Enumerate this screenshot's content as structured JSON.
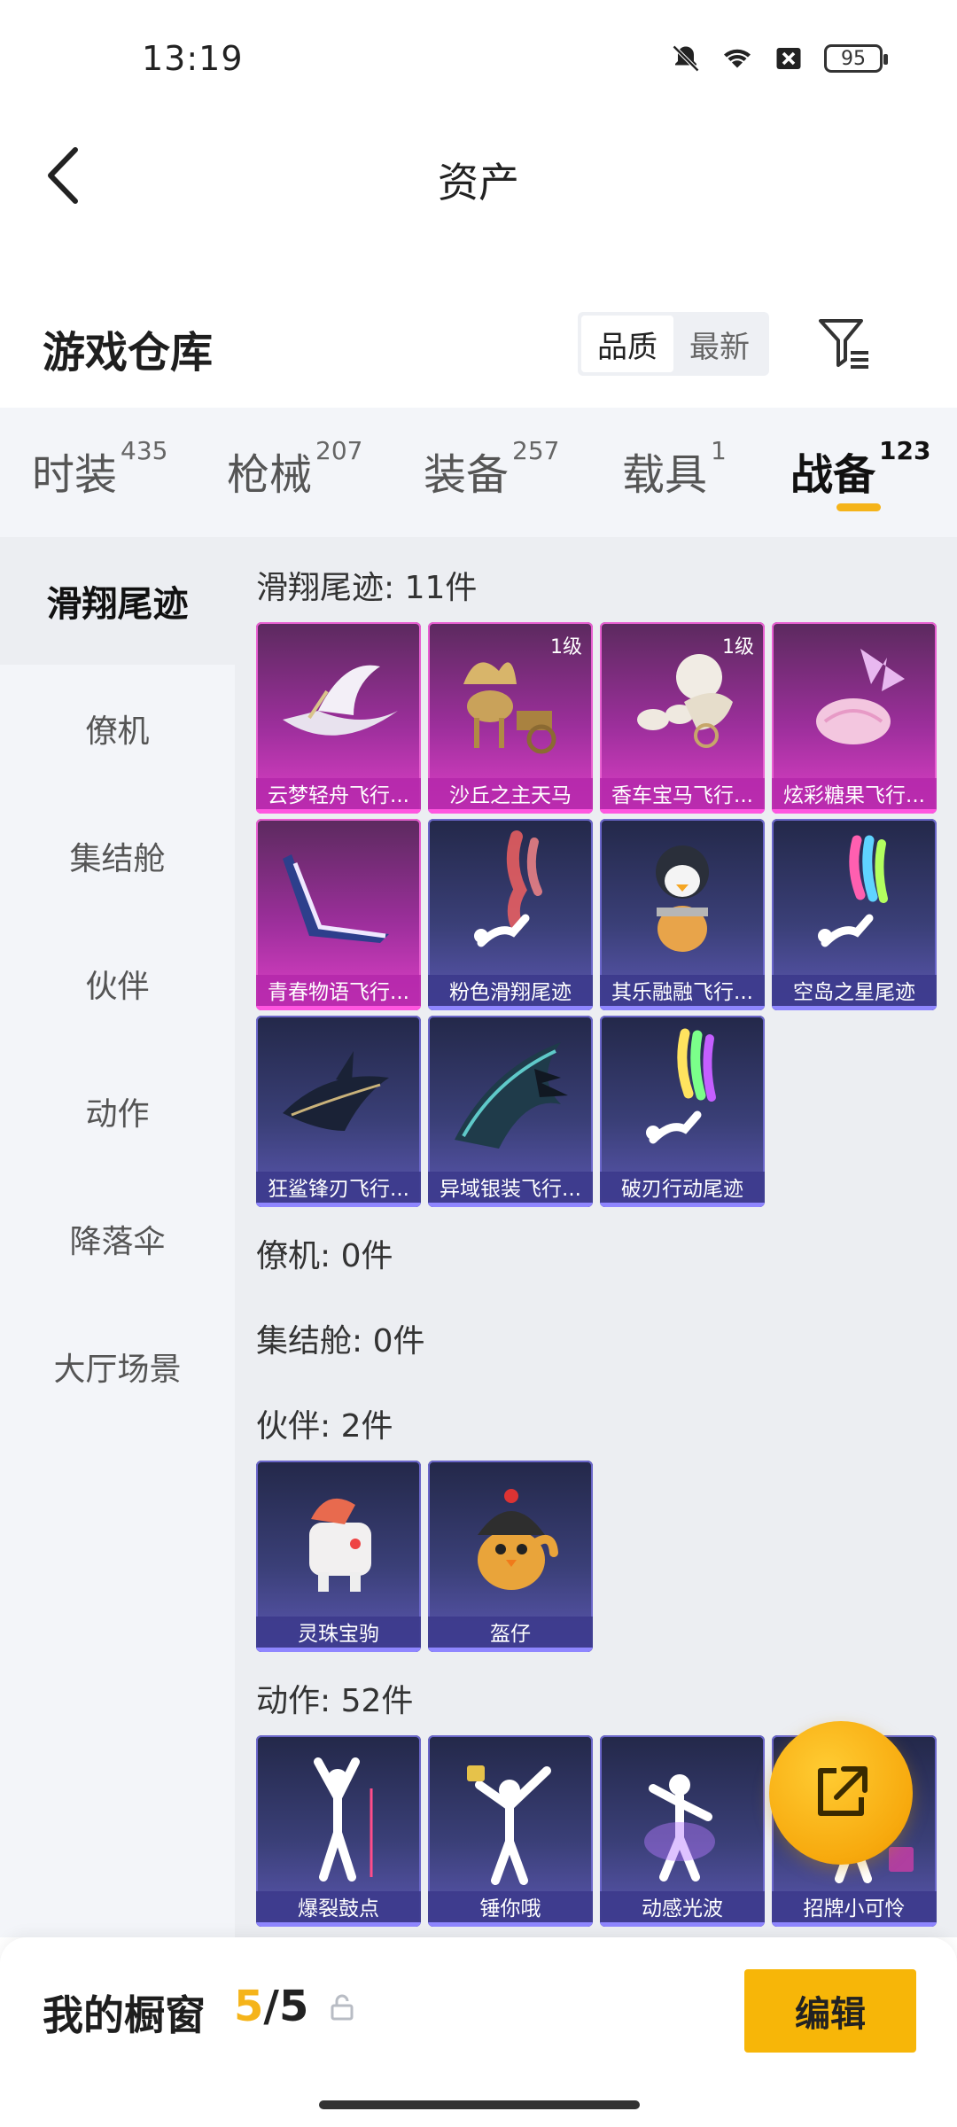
{
  "status_bar": {
    "time": "13:19",
    "battery": "95"
  },
  "header": {
    "title": "资产"
  },
  "warehouse": {
    "title": "游戏仓库",
    "sort_options": [
      "品质",
      "最新"
    ],
    "active_sort": "品质"
  },
  "tabs": [
    {
      "label": "时装",
      "count": "435"
    },
    {
      "label": "枪械",
      "count": "207"
    },
    {
      "label": "装备",
      "count": "257"
    },
    {
      "label": "载具",
      "count": "1"
    },
    {
      "label": "战备",
      "count": "123"
    }
  ],
  "active_tab": "战备",
  "sidebar": [
    {
      "label": "滑翔尾迹"
    },
    {
      "label": "僚机"
    },
    {
      "label": "集结舱"
    },
    {
      "label": "伙伴"
    },
    {
      "label": "动作"
    },
    {
      "label": "降落伞"
    },
    {
      "label": "大厅场景"
    }
  ],
  "sections": {
    "trails": {
      "heading": "滑翔尾迹: 11件",
      "items": [
        {
          "name": "云梦轻舟飞行...",
          "rarity": "pink",
          "level": "",
          "icon": "boat-glider-icon"
        },
        {
          "name": "沙丘之主天马",
          "rarity": "pink",
          "level": "1级",
          "icon": "pegasus-chariot-icon"
        },
        {
          "name": "香车宝马飞行...",
          "rarity": "pink",
          "level": "1级",
          "icon": "carriage-icon"
        },
        {
          "name": "炫彩糖果飞行...",
          "rarity": "pink",
          "level": "",
          "icon": "candy-icon"
        },
        {
          "name": "青春物语飞行...",
          "rarity": "pink",
          "level": "",
          "icon": "wing-glider-icon"
        },
        {
          "name": "粉色滑翔尾迹",
          "rarity": "navy",
          "level": "",
          "icon": "pink-smoke-icon"
        },
        {
          "name": "其乐融融飞行...",
          "rarity": "navy",
          "level": "",
          "icon": "penguin-icon"
        },
        {
          "name": "空岛之星尾迹",
          "rarity": "navy",
          "level": "",
          "icon": "rainbow-smoke-icon"
        },
        {
          "name": "狂鲨锋刃飞行...",
          "rarity": "navy",
          "level": "",
          "icon": "shark-icon"
        },
        {
          "name": "异域银装飞行...",
          "rarity": "navy",
          "level": "",
          "icon": "dark-wing-icon"
        },
        {
          "name": "破刃行动尾迹",
          "rarity": "navy",
          "level": "",
          "icon": "color-smoke-icon"
        }
      ]
    },
    "wingman": {
      "heading": "僚机: 0件"
    },
    "capsule": {
      "heading": "集结舱: 0件"
    },
    "partner": {
      "heading": "伙伴: 2件",
      "items": [
        {
          "name": "灵珠宝驹",
          "rarity": "navy",
          "level": "",
          "icon": "toy-horse-icon"
        },
        {
          "name": "盔仔",
          "rarity": "navy",
          "level": "",
          "icon": "helmet-chick-icon"
        }
      ]
    },
    "emote": {
      "heading": "动作: 52件",
      "items": [
        {
          "name": "爆裂鼓点",
          "rarity": "navy",
          "level": "",
          "icon": "dancer-icon"
        },
        {
          "name": "锤你哦",
          "rarity": "navy",
          "level": "",
          "icon": "hammer-dancer-icon"
        },
        {
          "name": "动感光波",
          "rarity": "navy",
          "level": "",
          "icon": "wave-dancer-icon"
        },
        {
          "name": "招牌小可怜",
          "rarity": "navy",
          "level": "",
          "icon": "sign-dancer-icon"
        }
      ]
    }
  },
  "showcase": {
    "title": "我的橱窗",
    "current": "5",
    "total": "5",
    "edit_label": "编辑"
  },
  "colors": {
    "accent": "#f5b41a",
    "pink_rarity": "#9d2f9c",
    "navy_rarity": "#3a3f77"
  }
}
